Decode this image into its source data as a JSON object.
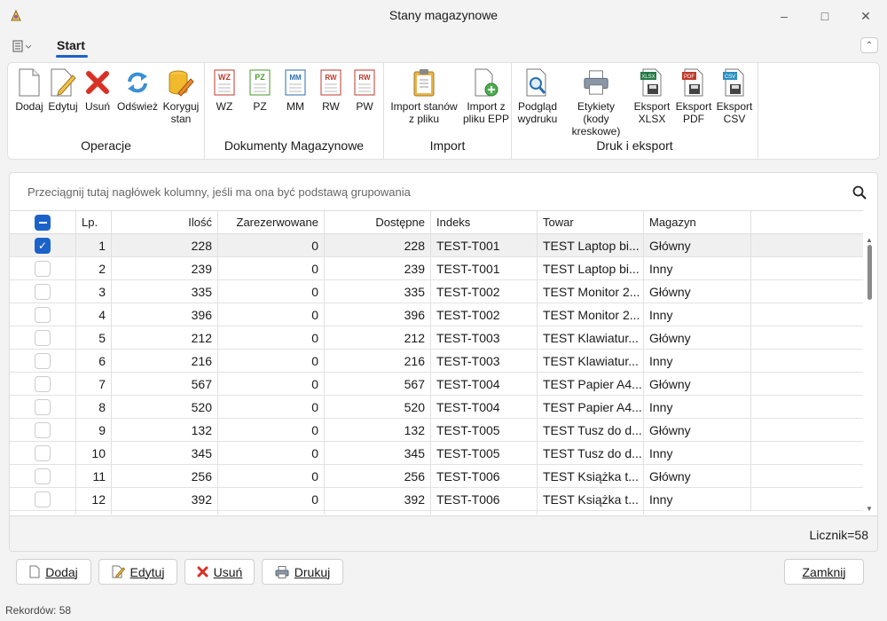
{
  "window": {
    "title": "Stany magazynowe"
  },
  "menu": {
    "tab": "Start"
  },
  "ribbon": {
    "groups": [
      {
        "label": "Operacje",
        "buttons": [
          "Dodaj",
          "Edytuj",
          "Usuń",
          "Odśwież",
          "Koryguj stan"
        ]
      },
      {
        "label": "Dokumenty Magazynowe",
        "buttons": [
          "WZ",
          "PZ",
          "MM",
          "RW",
          "PW"
        ]
      },
      {
        "label": "Import",
        "buttons": [
          "Import stanów z pliku",
          "Import z pliku EPP"
        ]
      },
      {
        "label": "Druk i eksport",
        "buttons": [
          "Podgląd wydruku",
          "Etykiety (kody kreskowe)",
          "Eksport XLSX",
          "Eksport PDF",
          "Eksport CSV"
        ]
      }
    ],
    "doc_icons": [
      "WZ",
      "PZ",
      "MM",
      "RW",
      "RW"
    ],
    "export_icons": [
      "XLSX",
      "PDF",
      "CSV"
    ]
  },
  "grid": {
    "group_hint": "Przeciągnij tutaj nagłówek kolumny, jeśli ma ona być podstawą grupowania",
    "columns": [
      "Lp.",
      "Ilość",
      "Zarezerwowane",
      "Dostępne",
      "Indeks",
      "Towar",
      "Magazyn"
    ],
    "rows": [
      {
        "lp": "1",
        "ilosc": "228",
        "zarez": "0",
        "dost": "228",
        "indeks": "TEST-T001",
        "towar": "TEST Laptop bi...",
        "magazyn": "Główny",
        "checked": true
      },
      {
        "lp": "2",
        "ilosc": "239",
        "zarez": "0",
        "dost": "239",
        "indeks": "TEST-T001",
        "towar": "TEST Laptop bi...",
        "magazyn": "Inny",
        "checked": false
      },
      {
        "lp": "3",
        "ilosc": "335",
        "zarez": "0",
        "dost": "335",
        "indeks": "TEST-T002",
        "towar": "TEST Monitor 2...",
        "magazyn": "Główny",
        "checked": false
      },
      {
        "lp": "4",
        "ilosc": "396",
        "zarez": "0",
        "dost": "396",
        "indeks": "TEST-T002",
        "towar": "TEST Monitor 2...",
        "magazyn": "Inny",
        "checked": false
      },
      {
        "lp": "5",
        "ilosc": "212",
        "zarez": "0",
        "dost": "212",
        "indeks": "TEST-T003",
        "towar": "TEST Klawiatur...",
        "magazyn": "Główny",
        "checked": false
      },
      {
        "lp": "6",
        "ilosc": "216",
        "zarez": "0",
        "dost": "216",
        "indeks": "TEST-T003",
        "towar": "TEST Klawiatur...",
        "magazyn": "Inny",
        "checked": false
      },
      {
        "lp": "7",
        "ilosc": "567",
        "zarez": "0",
        "dost": "567",
        "indeks": "TEST-T004",
        "towar": "TEST Papier A4...",
        "magazyn": "Główny",
        "checked": false
      },
      {
        "lp": "8",
        "ilosc": "520",
        "zarez": "0",
        "dost": "520",
        "indeks": "TEST-T004",
        "towar": "TEST Papier A4...",
        "magazyn": "Inny",
        "checked": false
      },
      {
        "lp": "9",
        "ilosc": "132",
        "zarez": "0",
        "dost": "132",
        "indeks": "TEST-T005",
        "towar": "TEST Tusz do d...",
        "magazyn": "Główny",
        "checked": false
      },
      {
        "lp": "10",
        "ilosc": "345",
        "zarez": "0",
        "dost": "345",
        "indeks": "TEST-T005",
        "towar": "TEST Tusz do d...",
        "magazyn": "Inny",
        "checked": false
      },
      {
        "lp": "11",
        "ilosc": "256",
        "zarez": "0",
        "dost": "256",
        "indeks": "TEST-T006",
        "towar": "TEST Książka t...",
        "magazyn": "Główny",
        "checked": false
      },
      {
        "lp": "12",
        "ilosc": "392",
        "zarez": "0",
        "dost": "392",
        "indeks": "TEST-T006",
        "towar": "TEST Książka t...",
        "magazyn": "Inny",
        "checked": false
      }
    ],
    "counter": "Licznik=58"
  },
  "bottom_buttons": {
    "add": "Dodaj",
    "edit": "Edytuj",
    "delete": "Usuń",
    "print": "Drukuj",
    "close": "Zamknij"
  },
  "status": {
    "records": "Rekordów: 58"
  },
  "colors": {
    "accent": "#1b63c9",
    "delete": "#d93025"
  }
}
